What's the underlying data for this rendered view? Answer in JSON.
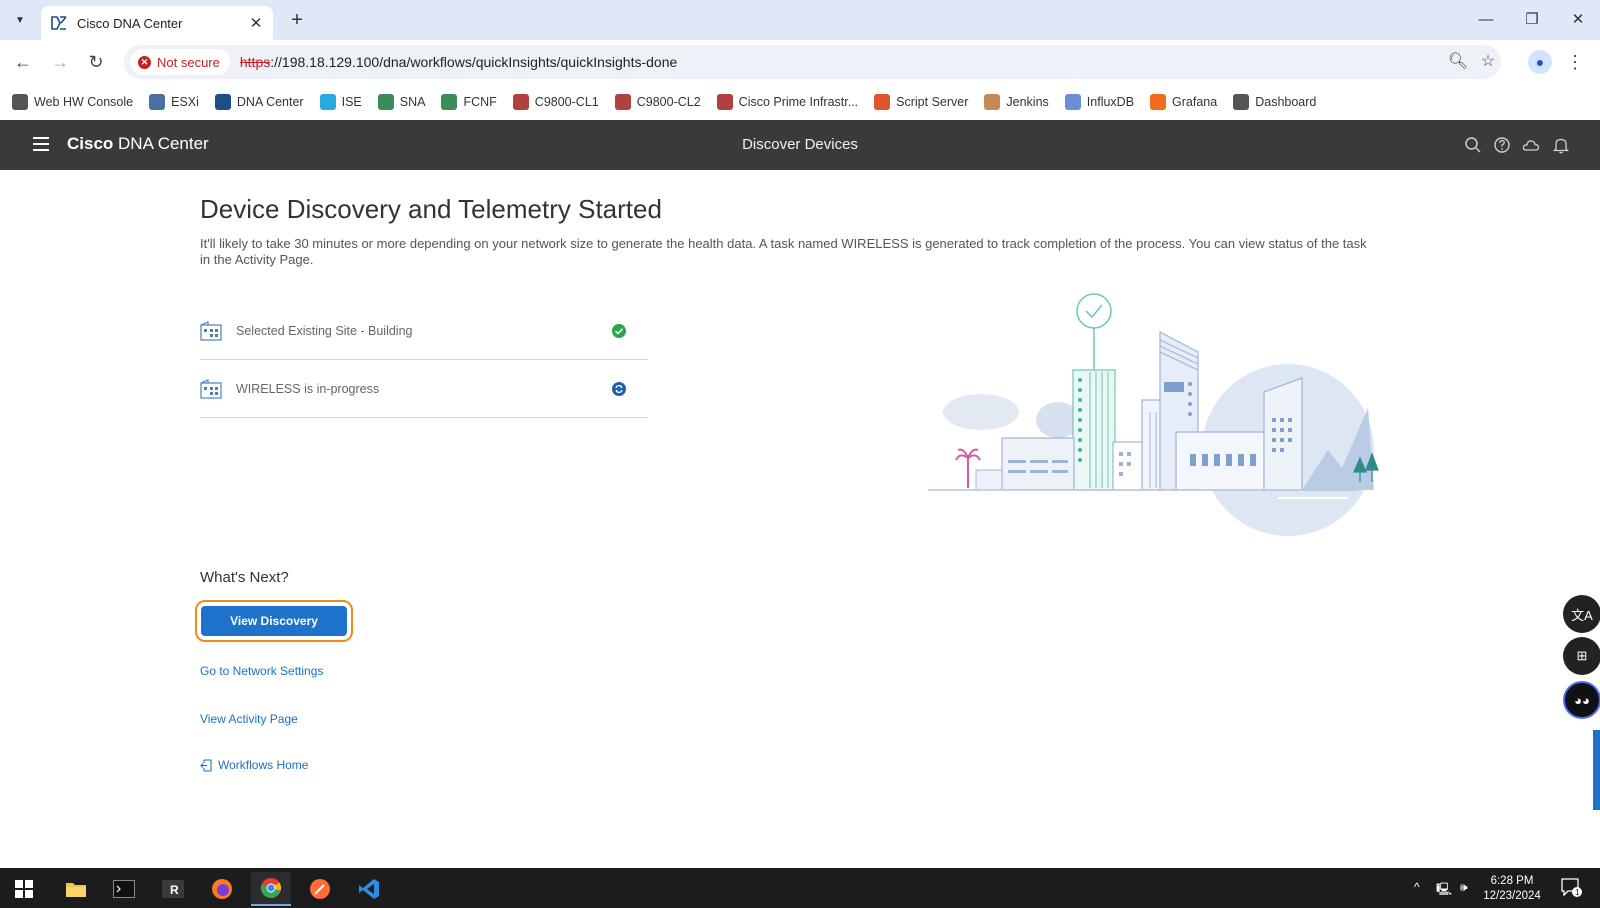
{
  "browser": {
    "tab_title": "Cisco DNA Center",
    "security_label": "Not secure",
    "url_scheme": "https",
    "url_rest": "://198.18.129.100/dna/workflows/quickInsights/quickInsights-done",
    "bookmarks": [
      {
        "label": "Web HW Console",
        "icon": "globe-icon",
        "color": "#555555"
      },
      {
        "label": "ESXi",
        "icon": "esxi-icon",
        "color": "#4a6fa5"
      },
      {
        "label": "DNA Center",
        "icon": "dnac-icon",
        "color": "#1b4f8a"
      },
      {
        "label": "ISE",
        "icon": "ise-icon",
        "color": "#2aa8e0"
      },
      {
        "label": "SNA",
        "icon": "sna-icon",
        "color": "#3c8c5a"
      },
      {
        "label": "FCNF",
        "icon": "fcnf-icon",
        "color": "#3c8c5a"
      },
      {
        "label": "C9800-CL1",
        "icon": "cisco-icon",
        "color": "#b0413e"
      },
      {
        "label": "C9800-CL2",
        "icon": "cisco-icon",
        "color": "#b0413e"
      },
      {
        "label": "Cisco Prime Infrastr...",
        "icon": "cisco-icon",
        "color": "#b0413e"
      },
      {
        "label": "Script Server",
        "icon": "script-icon",
        "color": "#e0552b"
      },
      {
        "label": "Jenkins",
        "icon": "jenkins-icon",
        "color": "#c48a5a"
      },
      {
        "label": "InfluxDB",
        "icon": "influx-icon",
        "color": "#6b8fd6"
      },
      {
        "label": "Grafana",
        "icon": "grafana-icon",
        "color": "#f26b1d"
      },
      {
        "label": "Dashboard",
        "icon": "globe-icon",
        "color": "#555555"
      }
    ]
  },
  "app": {
    "brand_bold": "Cisco",
    "brand_rest": " DNA Center",
    "header_title": "Discover Devices"
  },
  "main": {
    "title": "Device Discovery and Telemetry Started",
    "description": "It'll likely to take 30 minutes or more depending on your network size to generate the health data. A task named WIRELESS is generated to track completion of the process. You can view status of the task in the Activity Page.",
    "statuses": [
      {
        "label": "Selected Existing Site - Building",
        "state": "done"
      },
      {
        "label": "WIRELESS is in-progress",
        "state": "in-progress"
      }
    ],
    "next_title": "What's Next?",
    "view_discovery_label": "View Discovery",
    "links": {
      "network_settings": "Go to Network Settings",
      "activity_page": "View Activity Page",
      "workflows_home": "Workflows Home"
    }
  },
  "taskbar": {
    "time": "6:28 PM",
    "date": "12/23/2024",
    "notification_count": "1"
  },
  "colors": {
    "primary_button": "#1e72c9",
    "focus_ring": "#f08a1c",
    "header_bg": "#3a3a3a",
    "done": "#2aa54b",
    "in_progress": "#1f5fb3"
  }
}
